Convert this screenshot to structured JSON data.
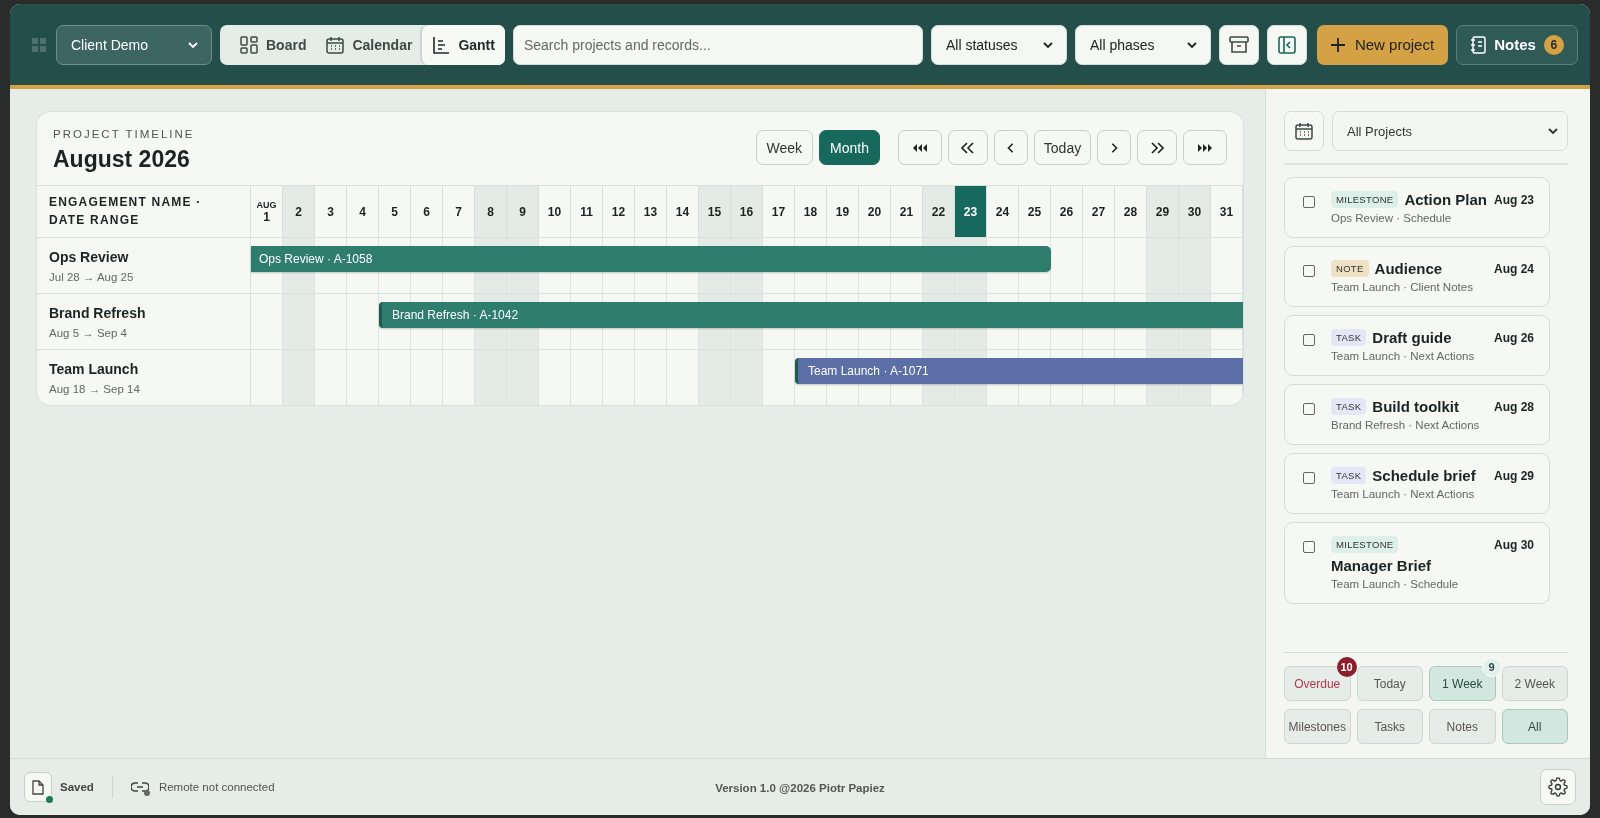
{
  "header": {
    "workspace": {
      "value": "Client Demo"
    },
    "views": [
      {
        "label": "Board",
        "selected": false
      },
      {
        "label": "Calendar",
        "selected": false
      },
      {
        "label": "Gantt",
        "selected": true
      }
    ],
    "search": {
      "placeholder": "Search projects and records..."
    },
    "status_filter": {
      "value": "All statuses"
    },
    "phase_filter": {
      "value": "All phases"
    },
    "new_project": {
      "label": "New project"
    },
    "notes": {
      "label": "Notes",
      "count": "6"
    }
  },
  "timeline": {
    "eyebrow": "PROJECT TIMELINE",
    "title": "August 2026",
    "scales": [
      {
        "label": "Week",
        "selected": false
      },
      {
        "label": "Month",
        "selected": true
      }
    ],
    "nav": [
      {
        "kind": "first"
      },
      {
        "kind": "fast-back"
      },
      {
        "kind": "back"
      },
      {
        "kind": "today",
        "label": "Today"
      },
      {
        "kind": "forward"
      },
      {
        "kind": "fast-forward"
      },
      {
        "kind": "last"
      }
    ],
    "name_column": "ENGAGEMENT NAME · DATE RANGE",
    "days": [
      {
        "month": "AUG",
        "label": "1",
        "weekend": false,
        "today": false
      },
      {
        "label": "2",
        "weekend": true,
        "today": false
      },
      {
        "label": "3",
        "weekend": false,
        "today": false
      },
      {
        "label": "4",
        "weekend": false,
        "today": false
      },
      {
        "label": "5",
        "weekend": false,
        "today": false
      },
      {
        "label": "6",
        "weekend": false,
        "today": false
      },
      {
        "label": "7",
        "weekend": false,
        "today": false
      },
      {
        "label": "8",
        "weekend": true,
        "today": false
      },
      {
        "label": "9",
        "weekend": true,
        "today": false
      },
      {
        "label": "10",
        "weekend": false,
        "today": false
      },
      {
        "label": "11",
        "weekend": false,
        "today": false
      },
      {
        "label": "12",
        "weekend": false,
        "today": false
      },
      {
        "label": "13",
        "weekend": false,
        "today": false
      },
      {
        "label": "14",
        "weekend": false,
        "today": false
      },
      {
        "label": "15",
        "weekend": true,
        "today": false
      },
      {
        "label": "16",
        "weekend": true,
        "today": false
      },
      {
        "label": "17",
        "weekend": false,
        "today": false
      },
      {
        "label": "18",
        "weekend": false,
        "today": false
      },
      {
        "label": "19",
        "weekend": false,
        "today": false
      },
      {
        "label": "20",
        "weekend": false,
        "today": false
      },
      {
        "label": "21",
        "weekend": false,
        "today": false
      },
      {
        "label": "22",
        "weekend": true,
        "today": false
      },
      {
        "label": "23",
        "weekend": true,
        "today": true
      },
      {
        "label": "24",
        "weekend": false,
        "today": false
      },
      {
        "label": "25",
        "weekend": false,
        "today": false
      },
      {
        "label": "26",
        "weekend": false,
        "today": false
      },
      {
        "label": "27",
        "weekend": false,
        "today": false
      },
      {
        "label": "28",
        "weekend": false,
        "today": false
      },
      {
        "label": "29",
        "weekend": true,
        "today": false
      },
      {
        "label": "30",
        "weekend": true,
        "today": false
      },
      {
        "label": "31",
        "weekend": false,
        "today": false
      }
    ],
    "rows": [
      {
        "name": "Ops Review",
        "range": "Jul 28 → Aug 25",
        "bar": {
          "label": "Ops Review · A-1058",
          "color": "#2e7d6f"
        }
      },
      {
        "name": "Brand Refresh",
        "range": "Aug 5 → Sep 4",
        "bar": {
          "label": "Brand Refresh · A-1042",
          "color": "#2e7d6f"
        }
      },
      {
        "name": "Team Launch",
        "range": "Aug 18 → Sep 14",
        "bar": {
          "label": "Team Launch · A-1071",
          "color": "#5b6fa6"
        }
      }
    ]
  },
  "agenda": {
    "project_filter": {
      "value": "All Projects"
    },
    "items": [
      {
        "tag": "MILESTONE",
        "color": "#dcefe9",
        "title": "Action Plan",
        "meta": "Ops Review · Schedule",
        "date": "Aug 23",
        "checked": false
      },
      {
        "tag": "NOTE",
        "color": "#efe2c4",
        "title": "Audience",
        "meta": "Team Launch · Client Notes",
        "date": "Aug 24",
        "checked": false
      },
      {
        "tag": "TASK",
        "color": "#e5e7f6",
        "title": "Draft guide",
        "meta": "Team Launch · Next Actions",
        "date": "Aug 26",
        "checked": false
      },
      {
        "tag": "TASK",
        "color": "#e5e7f6",
        "title": "Build toolkit",
        "meta": "Brand Refresh · Next Actions",
        "date": "Aug 28",
        "checked": false
      },
      {
        "tag": "TASK",
        "color": "#e5e7f6",
        "title": "Schedule brief",
        "meta": "Team Launch · Next Actions",
        "date": "Aug 29",
        "checked": false
      },
      {
        "tag": "MILESTONE",
        "color": "#dcefe9",
        "title": "Manager Brief",
        "meta": "Team Launch · Schedule",
        "date": "Aug 30",
        "checked": false
      }
    ],
    "range_filters": [
      {
        "kind": "overdue",
        "label": "Overdue",
        "selected": false,
        "badge": {
          "count": "10",
          "color": "#8b1e2b"
        }
      },
      {
        "kind": "range",
        "label": "Today",
        "selected": false
      },
      {
        "kind": "range",
        "label": "1 Week",
        "selected": true,
        "badge": {
          "count": "9",
          "color": "#e3f1ec"
        }
      },
      {
        "kind": "range",
        "label": "2 Week",
        "selected": false
      }
    ],
    "type_filters": [
      {
        "label": "Milestones",
        "selected": false
      },
      {
        "label": "Tasks",
        "selected": false
      },
      {
        "label": "Notes",
        "selected": false
      },
      {
        "label": "All",
        "selected": true
      }
    ]
  },
  "footer": {
    "saved": {
      "label": "Saved",
      "ok": true
    },
    "remote": {
      "label": "Remote not connected",
      "ok": false
    },
    "version": "Version 1.0 @2026 Piotr Papiez"
  }
}
